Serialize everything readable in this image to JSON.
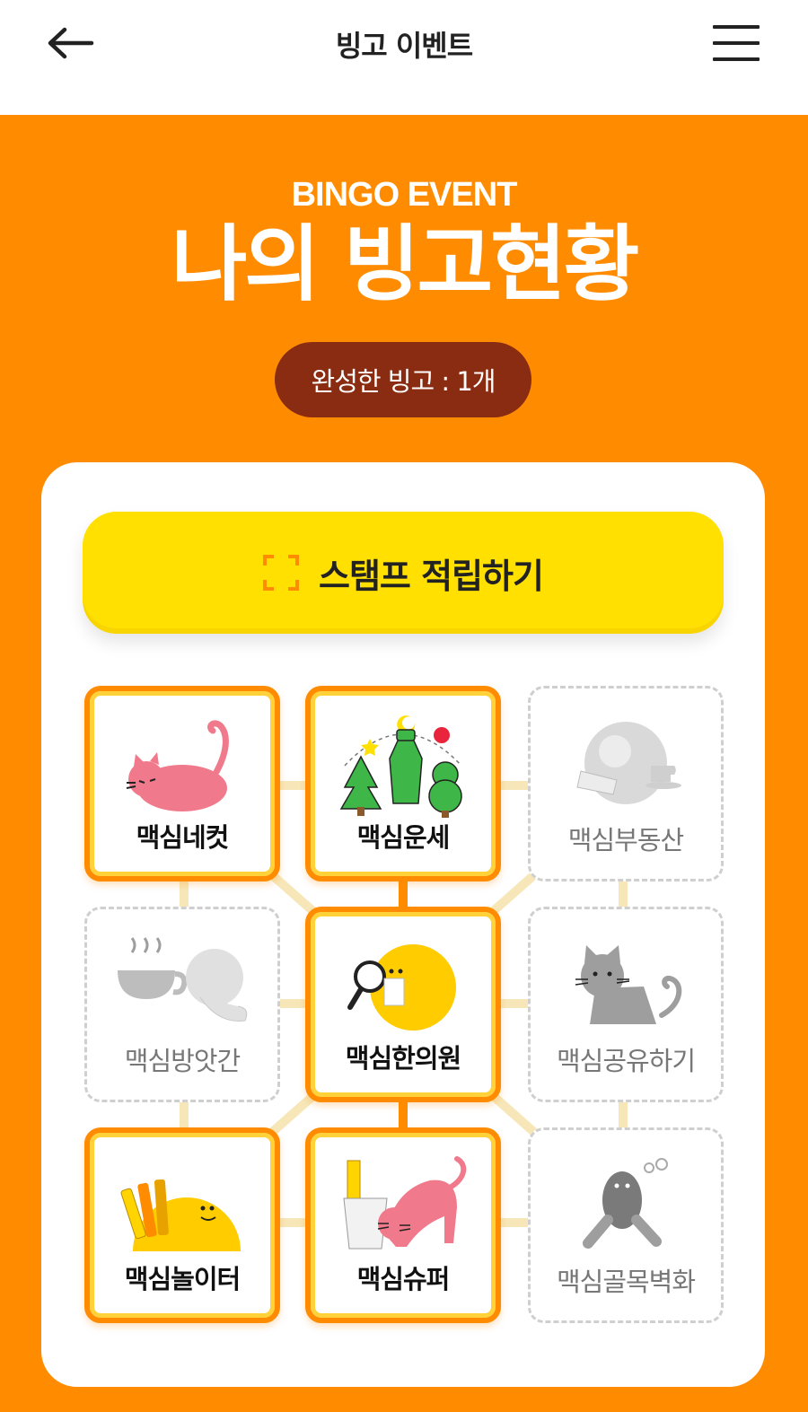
{
  "header": {
    "title": "빙고 이벤트",
    "back_icon": "arrow-left-icon",
    "menu_icon": "hamburger-menu-icon"
  },
  "hero": {
    "kicker": "BINGO EVENT",
    "title": "나의 빙고현황",
    "completed_label": "완성한 빙고 : 1개"
  },
  "stamp_button": {
    "label": "스탬프 적립하기",
    "icon": "scan-frame-icon"
  },
  "bingo": {
    "tiles": [
      {
        "label": "맥심네컷",
        "active": true,
        "icon": "pink-cat-icon"
      },
      {
        "label": "맥심운세",
        "active": true,
        "icon": "fortune-trees-icon"
      },
      {
        "label": "맥심부동산",
        "active": false,
        "icon": "character-with-cup-icon"
      },
      {
        "label": "맥심방앗간",
        "active": false,
        "icon": "teacup-character-icon"
      },
      {
        "label": "맥심한의원",
        "active": true,
        "icon": "magnifier-character-icon"
      },
      {
        "label": "맥심공유하기",
        "active": false,
        "icon": "grey-cat-icon"
      },
      {
        "label": "맥심놀이터",
        "active": true,
        "icon": "coffee-sticks-character-icon"
      },
      {
        "label": "맥심슈퍼",
        "active": true,
        "icon": "stretching-cat-icon"
      },
      {
        "label": "맥심골목벽화",
        "active": false,
        "icon": "thinking-character-icon"
      }
    ]
  },
  "colors": {
    "orange": "#ff8c00",
    "yellow": "#ffe000",
    "pill": "#8a2c12",
    "inactive_line": "#f7e7b8"
  }
}
